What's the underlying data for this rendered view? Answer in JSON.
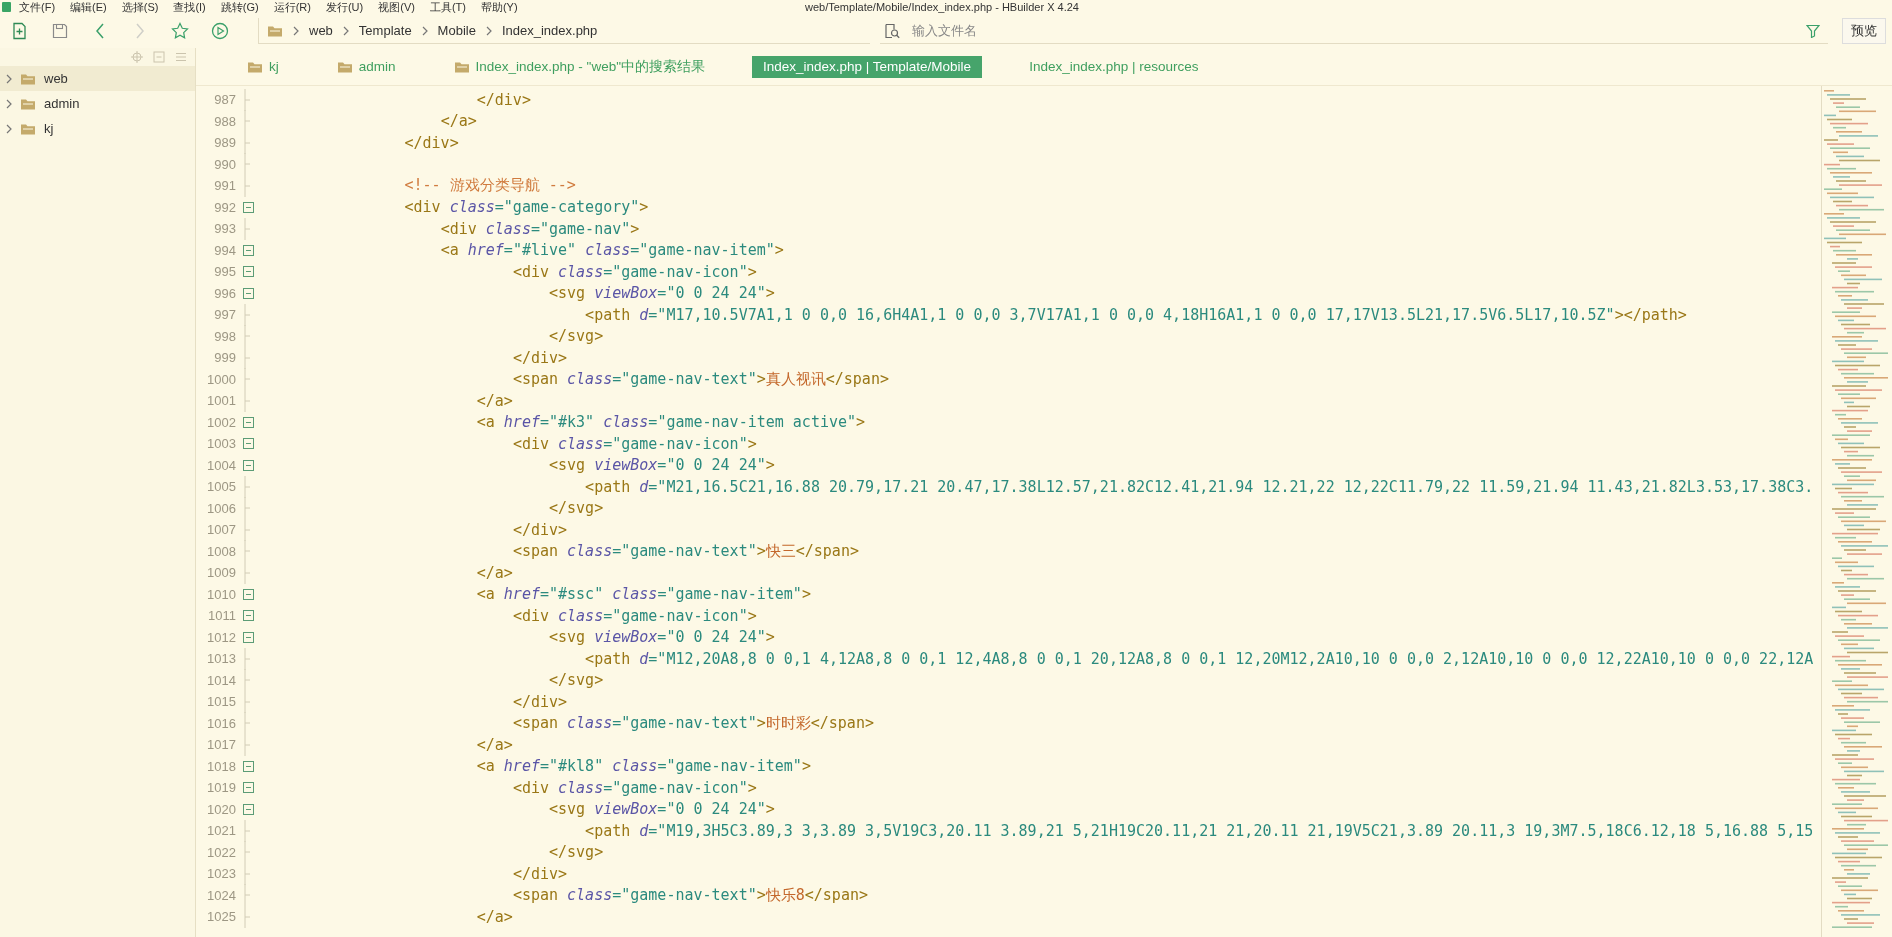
{
  "menu": [
    "文件(F)",
    "编辑(E)",
    "选择(S)",
    "查找(I)",
    "跳转(G)",
    "运行(R)",
    "发行(U)",
    "视图(V)",
    "工具(T)",
    "帮助(Y)"
  ],
  "window": {
    "title": "web/Template/Mobile/Index_index.php - HBuilder X 4.24"
  },
  "toolbar": {
    "nav": [
      {
        "disabled": false
      },
      {
        "disabled": true
      }
    ],
    "breadcrumb": [
      "web",
      "Template",
      "Mobile",
      "Index_index.php"
    ],
    "search": {
      "placeholder": "输入文件名"
    },
    "preview_button": "预览"
  },
  "sidebar": {
    "items": [
      {
        "label": "web",
        "selected": true
      },
      {
        "label": "admin",
        "selected": false
      },
      {
        "label": "kj",
        "selected": false
      }
    ]
  },
  "tabs": [
    {
      "label": "kj",
      "kind": "folder",
      "selected": false
    },
    {
      "label": "admin",
      "kind": "folder",
      "selected": false
    },
    {
      "label": "Index_index.php - \"web\"中的搜索结果",
      "kind": "folder",
      "selected": false
    },
    {
      "label": "Index_index.php | Template/Mobile",
      "kind": "file",
      "selected": true
    },
    {
      "label": "Index_index.php | resources",
      "kind": "file",
      "selected": false
    }
  ],
  "editor": {
    "lines": [
      {
        "number": "987",
        "fold": false,
        "text": "                        </div>"
      },
      {
        "number": "988",
        "fold": false,
        "text": "                    </a>"
      },
      {
        "number": "989",
        "fold": false,
        "text": "                </div>"
      },
      {
        "number": "990",
        "fold": false
      },
      {
        "number": "991",
        "fold": false,
        "text": "                <!-- 游戏分类导航 -->"
      },
      {
        "number": "992",
        "fold": true,
        "text": "                <div class=\"game-category\">"
      },
      {
        "number": "993",
        "fold": false,
        "text": "                    <div class=\"game-nav\">"
      },
      {
        "number": "994",
        "fold": true,
        "text": "                    <a href=\"#live\" class=\"game-nav-item\">"
      },
      {
        "number": "995",
        "fold": true,
        "text": "                            <div class=\"game-nav-icon\">"
      },
      {
        "number": "996",
        "fold": true,
        "text": "                                <svg viewBox=\"0 0 24 24\">"
      },
      {
        "number": "997",
        "fold": false,
        "text": "                                    <path d=\"M17,10.5V7A1,1 0 0,0 16,6H4A1,1 0 0,0 3,7V17A1,1 0 0,0 4,18H16A1,1 0 0,0 17,17V13.5L21,17.5V6.5L17,10.5Z\"></path>"
      },
      {
        "number": "998",
        "fold": false,
        "text": "                                </svg>"
      },
      {
        "number": "999",
        "fold": false,
        "text": "                            </div>"
      },
      {
        "number": "1000",
        "fold": false,
        "text": "                            <span class=\"game-nav-text\">真人视讯</span>"
      },
      {
        "number": "1001",
        "fold": false,
        "text": "                        </a>"
      },
      {
        "number": "1002",
        "fold": true,
        "text": "                        <a href=\"#k3\" class=\"game-nav-item active\">"
      },
      {
        "number": "1003",
        "fold": true,
        "text": "                            <div class=\"game-nav-icon\">"
      },
      {
        "number": "1004",
        "fold": true,
        "text": "                                <svg viewBox=\"0 0 24 24\">"
      },
      {
        "number": "1005",
        "fold": false,
        "text": "                                    <path d=\"M21,16.5C21,16.88 20.79,17.21 20.47,17.38L12.57,21.82C12.41,21.94 12.21,22 12,22C11.79,22 11.59,21.94 11.43,21.82L3.53,17.38C3."
      },
      {
        "number": "1006",
        "fold": false,
        "text": "                                </svg>"
      },
      {
        "number": "1007",
        "fold": false,
        "text": "                            </div>"
      },
      {
        "number": "1008",
        "fold": false,
        "text": "                            <span class=\"game-nav-text\">快三</span>"
      },
      {
        "number": "1009",
        "fold": false,
        "text": "                        </a>"
      },
      {
        "number": "1010",
        "fold": true,
        "text": "                        <a href=\"#ssc\" class=\"game-nav-item\">"
      },
      {
        "number": "1011",
        "fold": true,
        "text": "                            <div class=\"game-nav-icon\">"
      },
      {
        "number": "1012",
        "fold": true,
        "text": "                                <svg viewBox=\"0 0 24 24\">"
      },
      {
        "number": "1013",
        "fold": false,
        "text": "                                    <path d=\"M12,20A8,8 0 0,1 4,12A8,8 0 0,1 12,4A8,8 0 0,1 20,12A8,8 0 0,1 12,20M12,2A10,10 0 0,0 2,12A10,10 0 0,0 12,22A10,10 0 0,0 22,12A"
      },
      {
        "number": "1014",
        "fold": false,
        "text": "                                </svg>"
      },
      {
        "number": "1015",
        "fold": false,
        "text": "                            </div>"
      },
      {
        "number": "1016",
        "fold": false,
        "text": "                            <span class=\"game-nav-text\">时时彩</span>"
      },
      {
        "number": "1017",
        "fold": false,
        "text": "                        </a>"
      },
      {
        "number": "1018",
        "fold": true,
        "text": "                        <a href=\"#kl8\" class=\"game-nav-item\">"
      },
      {
        "number": "1019",
        "fold": true,
        "text": "                            <div class=\"game-nav-icon\">"
      },
      {
        "number": "1020",
        "fold": true,
        "text": "                                <svg viewBox=\"0 0 24 24\">"
      },
      {
        "number": "1021",
        "fold": false,
        "text": "                                    <path d=\"M19,3H5C3.89,3 3,3.89 3,5V19C3,20.11 3.89,21 5,21H19C20.11,21 21,20.11 21,19V5C21,3.89 20.11,3 19,3M7.5,18C6.12,18 5,16.88 5,15"
      },
      {
        "number": "1022",
        "fold": false,
        "text": "                                </svg>"
      },
      {
        "number": "1023",
        "fold": false,
        "text": "                            </div>"
      },
      {
        "number": "1024",
        "fold": false,
        "text": "                            <span class=\"game-nav-text\">快乐8</span>"
      },
      {
        "number": "1025",
        "fold": false,
        "text": "                        </a>"
      }
    ]
  }
}
